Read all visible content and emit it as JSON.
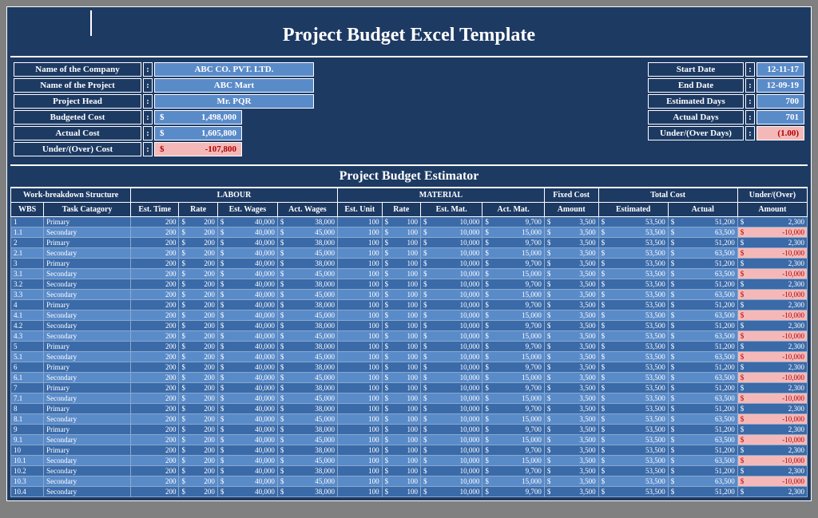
{
  "title": "Project Budget Excel Template",
  "info_left": [
    {
      "label": "Name of the Company",
      "value": "ABC CO. PVT. LTD.",
      "type": "wide"
    },
    {
      "label": "Name of the Project",
      "value": "ABC Mart",
      "type": "wide"
    },
    {
      "label": "Project Head",
      "value": "Mr. PQR",
      "type": "wide"
    },
    {
      "label": "Budgeted Cost",
      "value": "1,498,000",
      "type": "money"
    },
    {
      "label": "Actual Cost",
      "value": "1,605,800",
      "type": "money"
    },
    {
      "label": "Under/(Over) Cost",
      "value": "-107,800",
      "type": "money-neg"
    }
  ],
  "info_right": [
    {
      "label": "Start Date",
      "value": "12-11-17",
      "type": "narrow"
    },
    {
      "label": "End Date",
      "value": "12-09-19",
      "type": "narrow"
    },
    {
      "label": "Estimated Days",
      "value": "700",
      "type": "narrow"
    },
    {
      "label": "Actual Days",
      "value": "701",
      "type": "narrow"
    },
    {
      "label": "Under/(Over Days)",
      "value": "(1.00)",
      "type": "narrow-neg"
    }
  ],
  "section_title": "Project Budget Estimator",
  "group_headers": [
    {
      "label": "Work-breakdown Structure",
      "span": 2
    },
    {
      "label": "LABOUR",
      "span": 4
    },
    {
      "label": "MATERIAL",
      "span": 4
    },
    {
      "label": "Fixed Cost",
      "span": 1
    },
    {
      "label": "Total Cost",
      "span": 2
    },
    {
      "label": "Under/(Over)",
      "span": 1
    }
  ],
  "col_headers": [
    "WBS",
    "Task Catagory",
    "Est. Time",
    "Rate",
    "Est. Wages",
    "Act. Wages",
    "Est. Unit",
    "Rate",
    "Est. Mat.",
    "Act. Mat.",
    "Amount",
    "Estimated",
    "Actual",
    "Amount"
  ],
  "chart_data": {
    "type": "table",
    "rows": [
      {
        "wbs": "1",
        "task": "Primary",
        "est_time": 200,
        "rate": 200,
        "est_wages": 40000,
        "act_wages": 38000,
        "est_unit": 100,
        "mrate": 100,
        "est_mat": 10000,
        "act_mat": 9700,
        "fixed": 3500,
        "total_est": 53500,
        "total_act": 51200,
        "uo": 2300
      },
      {
        "wbs": "1.1",
        "task": "Secondary",
        "est_time": 200,
        "rate": 200,
        "est_wages": 40000,
        "act_wages": 45000,
        "est_unit": 100,
        "mrate": 100,
        "est_mat": 10000,
        "act_mat": 15000,
        "fixed": 3500,
        "total_est": 53500,
        "total_act": 63500,
        "uo": -10000
      },
      {
        "wbs": "2",
        "task": "Primary",
        "est_time": 200,
        "rate": 200,
        "est_wages": 40000,
        "act_wages": 38000,
        "est_unit": 100,
        "mrate": 100,
        "est_mat": 10000,
        "act_mat": 9700,
        "fixed": 3500,
        "total_est": 53500,
        "total_act": 51200,
        "uo": 2300
      },
      {
        "wbs": "2.1",
        "task": "Secondary",
        "est_time": 200,
        "rate": 200,
        "est_wages": 40000,
        "act_wages": 45000,
        "est_unit": 100,
        "mrate": 100,
        "est_mat": 10000,
        "act_mat": 15000,
        "fixed": 3500,
        "total_est": 53500,
        "total_act": 63500,
        "uo": -10000
      },
      {
        "wbs": "3",
        "task": "Primary",
        "est_time": 200,
        "rate": 200,
        "est_wages": 40000,
        "act_wages": 38000,
        "est_unit": 100,
        "mrate": 100,
        "est_mat": 10000,
        "act_mat": 9700,
        "fixed": 3500,
        "total_est": 53500,
        "total_act": 51200,
        "uo": 2300
      },
      {
        "wbs": "3.1",
        "task": "Secondary",
        "est_time": 200,
        "rate": 200,
        "est_wages": 40000,
        "act_wages": 45000,
        "est_unit": 100,
        "mrate": 100,
        "est_mat": 10000,
        "act_mat": 15000,
        "fixed": 3500,
        "total_est": 53500,
        "total_act": 63500,
        "uo": -10000
      },
      {
        "wbs": "3.2",
        "task": "Secondary",
        "est_time": 200,
        "rate": 200,
        "est_wages": 40000,
        "act_wages": 38000,
        "est_unit": 100,
        "mrate": 100,
        "est_mat": 10000,
        "act_mat": 9700,
        "fixed": 3500,
        "total_est": 53500,
        "total_act": 51200,
        "uo": 2300
      },
      {
        "wbs": "3.3",
        "task": "Secondary",
        "est_time": 200,
        "rate": 200,
        "est_wages": 40000,
        "act_wages": 45000,
        "est_unit": 100,
        "mrate": 100,
        "est_mat": 10000,
        "act_mat": 15000,
        "fixed": 3500,
        "total_est": 53500,
        "total_act": 63500,
        "uo": -10000
      },
      {
        "wbs": "4",
        "task": "Primary",
        "est_time": 200,
        "rate": 200,
        "est_wages": 40000,
        "act_wages": 38000,
        "est_unit": 100,
        "mrate": 100,
        "est_mat": 10000,
        "act_mat": 9700,
        "fixed": 3500,
        "total_est": 53500,
        "total_act": 51200,
        "uo": 2300
      },
      {
        "wbs": "4.1",
        "task": "Secondary",
        "est_time": 200,
        "rate": 200,
        "est_wages": 40000,
        "act_wages": 45000,
        "est_unit": 100,
        "mrate": 100,
        "est_mat": 10000,
        "act_mat": 15000,
        "fixed": 3500,
        "total_est": 53500,
        "total_act": 63500,
        "uo": -10000
      },
      {
        "wbs": "4.2",
        "task": "Secondary",
        "est_time": 200,
        "rate": 200,
        "est_wages": 40000,
        "act_wages": 38000,
        "est_unit": 100,
        "mrate": 100,
        "est_mat": 10000,
        "act_mat": 9700,
        "fixed": 3500,
        "total_est": 53500,
        "total_act": 51200,
        "uo": 2300
      },
      {
        "wbs": "4.3",
        "task": "Secondary",
        "est_time": 200,
        "rate": 200,
        "est_wages": 40000,
        "act_wages": 45000,
        "est_unit": 100,
        "mrate": 100,
        "est_mat": 10000,
        "act_mat": 15000,
        "fixed": 3500,
        "total_est": 53500,
        "total_act": 63500,
        "uo": -10000
      },
      {
        "wbs": "5",
        "task": "Primary",
        "est_time": 200,
        "rate": 200,
        "est_wages": 40000,
        "act_wages": 38000,
        "est_unit": 100,
        "mrate": 100,
        "est_mat": 10000,
        "act_mat": 9700,
        "fixed": 3500,
        "total_est": 53500,
        "total_act": 51200,
        "uo": 2300
      },
      {
        "wbs": "5.1",
        "task": "Secondary",
        "est_time": 200,
        "rate": 200,
        "est_wages": 40000,
        "act_wages": 45000,
        "est_unit": 100,
        "mrate": 100,
        "est_mat": 10000,
        "act_mat": 15000,
        "fixed": 3500,
        "total_est": 53500,
        "total_act": 63500,
        "uo": -10000
      },
      {
        "wbs": "6",
        "task": "Primary",
        "est_time": 200,
        "rate": 200,
        "est_wages": 40000,
        "act_wages": 38000,
        "est_unit": 100,
        "mrate": 100,
        "est_mat": 10000,
        "act_mat": 9700,
        "fixed": 3500,
        "total_est": 53500,
        "total_act": 51200,
        "uo": 2300
      },
      {
        "wbs": "6.1",
        "task": "Secondary",
        "est_time": 200,
        "rate": 200,
        "est_wages": 40000,
        "act_wages": 45000,
        "est_unit": 100,
        "mrate": 100,
        "est_mat": 10000,
        "act_mat": 15000,
        "fixed": 3500,
        "total_est": 53500,
        "total_act": 63500,
        "uo": -10000
      },
      {
        "wbs": "7",
        "task": "Primary",
        "est_time": 200,
        "rate": 200,
        "est_wages": 40000,
        "act_wages": 38000,
        "est_unit": 100,
        "mrate": 100,
        "est_mat": 10000,
        "act_mat": 9700,
        "fixed": 3500,
        "total_est": 53500,
        "total_act": 51200,
        "uo": 2300
      },
      {
        "wbs": "7.1",
        "task": "Secondary",
        "est_time": 200,
        "rate": 200,
        "est_wages": 40000,
        "act_wages": 45000,
        "est_unit": 100,
        "mrate": 100,
        "est_mat": 10000,
        "act_mat": 15000,
        "fixed": 3500,
        "total_est": 53500,
        "total_act": 63500,
        "uo": -10000
      },
      {
        "wbs": "8",
        "task": "Primary",
        "est_time": 200,
        "rate": 200,
        "est_wages": 40000,
        "act_wages": 38000,
        "est_unit": 100,
        "mrate": 100,
        "est_mat": 10000,
        "act_mat": 9700,
        "fixed": 3500,
        "total_est": 53500,
        "total_act": 51200,
        "uo": 2300
      },
      {
        "wbs": "8.1",
        "task": "Secondary",
        "est_time": 200,
        "rate": 200,
        "est_wages": 40000,
        "act_wages": 45000,
        "est_unit": 100,
        "mrate": 100,
        "est_mat": 10000,
        "act_mat": 15000,
        "fixed": 3500,
        "total_est": 53500,
        "total_act": 63500,
        "uo": -10000
      },
      {
        "wbs": "9",
        "task": "Primary",
        "est_time": 200,
        "rate": 200,
        "est_wages": 40000,
        "act_wages": 38000,
        "est_unit": 100,
        "mrate": 100,
        "est_mat": 10000,
        "act_mat": 9700,
        "fixed": 3500,
        "total_est": 53500,
        "total_act": 51200,
        "uo": 2300
      },
      {
        "wbs": "9.1",
        "task": "Secondary",
        "est_time": 200,
        "rate": 200,
        "est_wages": 40000,
        "act_wages": 45000,
        "est_unit": 100,
        "mrate": 100,
        "est_mat": 10000,
        "act_mat": 15000,
        "fixed": 3500,
        "total_est": 53500,
        "total_act": 63500,
        "uo": -10000
      },
      {
        "wbs": "10",
        "task": "Primary",
        "est_time": 200,
        "rate": 200,
        "est_wages": 40000,
        "act_wages": 38000,
        "est_unit": 100,
        "mrate": 100,
        "est_mat": 10000,
        "act_mat": 9700,
        "fixed": 3500,
        "total_est": 53500,
        "total_act": 51200,
        "uo": 2300
      },
      {
        "wbs": "10.1",
        "task": "Secondary",
        "est_time": 200,
        "rate": 200,
        "est_wages": 40000,
        "act_wages": 45000,
        "est_unit": 100,
        "mrate": 100,
        "est_mat": 10000,
        "act_mat": 15000,
        "fixed": 3500,
        "total_est": 53500,
        "total_act": 63500,
        "uo": -10000
      },
      {
        "wbs": "10.2",
        "task": "Secondary",
        "est_time": 200,
        "rate": 200,
        "est_wages": 40000,
        "act_wages": 38000,
        "est_unit": 100,
        "mrate": 100,
        "est_mat": 10000,
        "act_mat": 9700,
        "fixed": 3500,
        "total_est": 53500,
        "total_act": 51200,
        "uo": 2300
      },
      {
        "wbs": "10.3",
        "task": "Secondary",
        "est_time": 200,
        "rate": 200,
        "est_wages": 40000,
        "act_wages": 45000,
        "est_unit": 100,
        "mrate": 100,
        "est_mat": 10000,
        "act_mat": 15000,
        "fixed": 3500,
        "total_est": 53500,
        "total_act": 63500,
        "uo": -10000
      },
      {
        "wbs": "10.4",
        "task": "Secondary",
        "est_time": 200,
        "rate": 200,
        "est_wages": 40000,
        "act_wages": 38000,
        "est_unit": 100,
        "mrate": 100,
        "est_mat": 10000,
        "act_mat": 9700,
        "fixed": 3500,
        "total_est": 53500,
        "total_act": 51200,
        "uo": 2300
      }
    ]
  }
}
